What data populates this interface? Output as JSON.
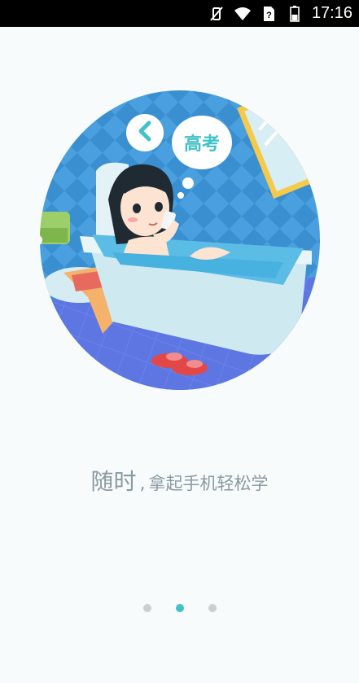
{
  "status_bar": {
    "time": "17:16",
    "icons": [
      "vibrate-off-icon",
      "wifi-icon",
      "no-sim-icon",
      "battery-icon"
    ]
  },
  "illustration": {
    "thought_bubble_text": "高考",
    "back_button_icon": "chevron-left-icon"
  },
  "tagline": {
    "emphasis": "随时",
    "separator": ",",
    "rest": "拿起手机轻松学"
  },
  "pager": {
    "count": 3,
    "active_index": 1
  },
  "colors": {
    "accent": "#3fc2c8",
    "text": "#8a9aa0",
    "background": "#f7fbfc"
  }
}
